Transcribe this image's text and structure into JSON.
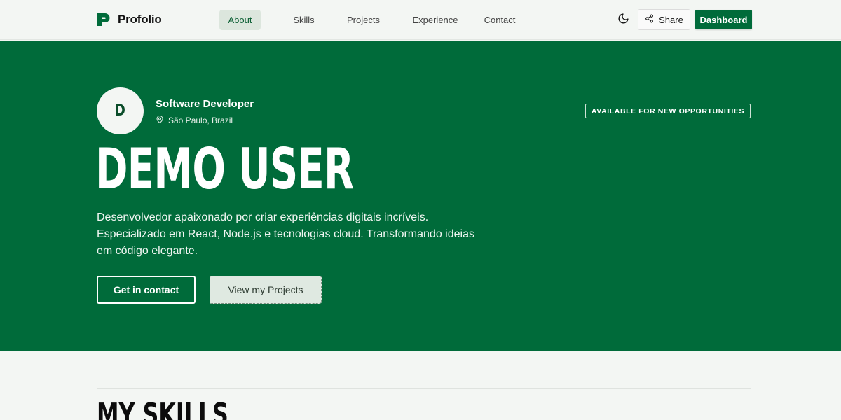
{
  "brand": {
    "name": "Profolio",
    "color": "#006b3a"
  },
  "nav": {
    "items": [
      {
        "label": "About",
        "active": true
      },
      {
        "label": "Skills",
        "active": false
      },
      {
        "label": "Projects",
        "active": false
      },
      {
        "label": "Experience",
        "active": false
      },
      {
        "label": "Contact",
        "active": false
      }
    ]
  },
  "header_actions": {
    "theme_icon": "moon-icon",
    "share_label": "Share",
    "share_icon": "share-icon",
    "dashboard_label": "Dashboard"
  },
  "hero": {
    "avatar_initial": "D",
    "role": "Software Developer",
    "location": "São Paulo, Brazil",
    "location_icon": "map-pin-icon",
    "availability": "AVAILABLE FOR NEW OPPORTUNITIES",
    "name": "DEMO USER",
    "description": "Desenvolvedor apaixonado por criar experiências digitais incríveis. Especializado em React, Node.js e tecnologias cloud. Transformando ideias em código elegante.",
    "primary_cta": "Get in contact",
    "secondary_cta": "View my Projects",
    "background": "#006b3a"
  },
  "skills": {
    "title": "MY SKILLS"
  }
}
